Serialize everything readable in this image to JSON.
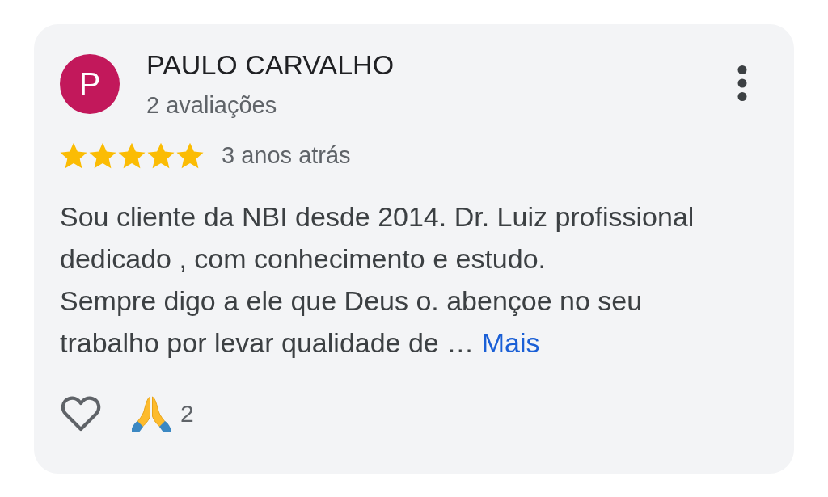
{
  "review": {
    "author": {
      "initial": "P",
      "name": "PAULO CARVALHO",
      "review_count": "2 avaliações"
    },
    "stars": 5,
    "time": "3 anos atrás",
    "text": "Sou cliente da NBI desde 2014. Dr. Luiz profissional dedicado , com conhecimento e estudo.\nSempre digo a ele que Deus o. abençoe no seu trabalho por levar qualidade de …",
    "more_link": "Mais",
    "reactions": [
      {
        "kind": "heart"
      },
      {
        "kind": "praying-hands",
        "count": "2"
      }
    ]
  }
}
